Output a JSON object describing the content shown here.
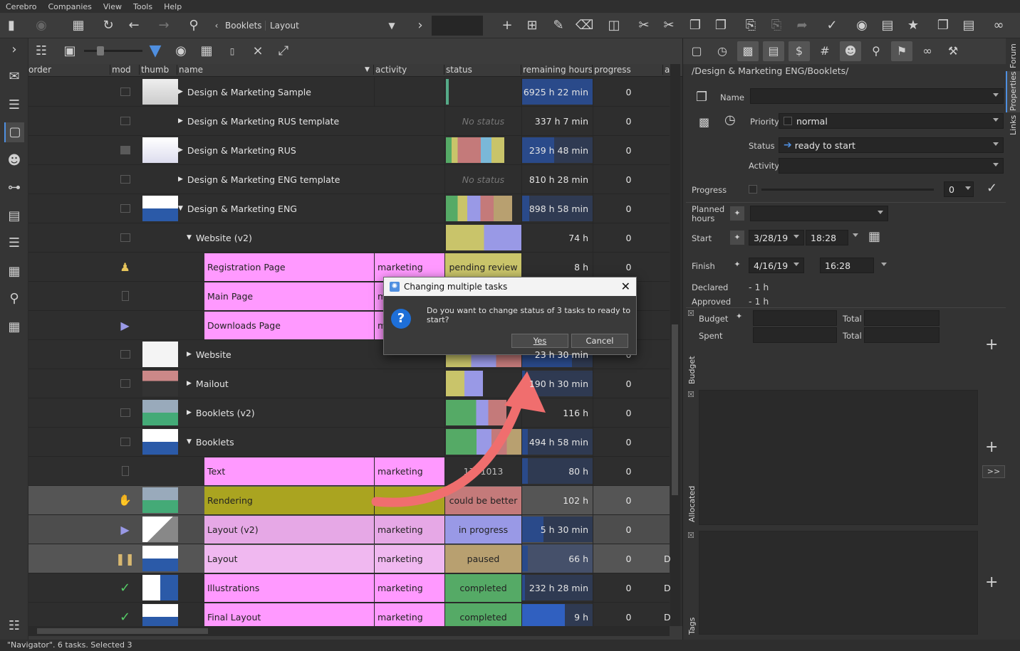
{
  "menu": [
    "Cerebro",
    "Companies",
    "View",
    "Tools",
    "Help"
  ],
  "breadcrumb": [
    "Booklets",
    "Layout"
  ],
  "columns": {
    "order": "order",
    "mod": "mod",
    "thumb": "thumb",
    "name": "name",
    "activity": "activity",
    "status": "status",
    "hours": "remaining hours",
    "progress": "progress",
    "extra": "a"
  },
  "rows": [
    {
      "name": "Design & Marketing Sample",
      "activity": "",
      "status": "",
      "hours": "6925 h 22 min",
      "progress": "0"
    },
    {
      "name": "Design & Marketing RUS template",
      "activity": "",
      "status": "No status",
      "hours": "337 h 7 min",
      "progress": "0"
    },
    {
      "name": "Design & Marketing RUS",
      "activity": "",
      "status": "",
      "hours": "239 h 48 min",
      "progress": "0"
    },
    {
      "name": "Design & Marketing ENG template",
      "activity": "",
      "status": "No status",
      "hours": "810 h 28 min",
      "progress": "0"
    },
    {
      "name": "Design & Marketing ENG",
      "activity": "",
      "status": "",
      "hours": "898 h 58 min",
      "progress": "0"
    },
    {
      "name": "Website (v2)",
      "activity": "",
      "status": "",
      "hours": "74 h",
      "progress": "0"
    },
    {
      "name": "Registration Page",
      "activity": "marketing",
      "status": "pending review",
      "hours": "8 h",
      "progress": "0"
    },
    {
      "name": "Main Page",
      "activity": "m",
      "status": "",
      "hours": "",
      "progress": ""
    },
    {
      "name": "Downloads Page",
      "activity": "m",
      "status": "",
      "hours": "",
      "progress": ""
    },
    {
      "name": "Website",
      "activity": "",
      "status": "",
      "hours": "23 h 30 min",
      "progress": "0"
    },
    {
      "name": "Mailout",
      "activity": "",
      "status": "",
      "hours": "190 h 30 min",
      "progress": "0"
    },
    {
      "name": "Booklets (v2)",
      "activity": "",
      "status": "",
      "hours": "116 h",
      "progress": "0"
    },
    {
      "name": "Booklets",
      "activity": "",
      "status": "",
      "hours": "494 h 58 min",
      "progress": "0"
    },
    {
      "name": "Text",
      "activity": "marketing",
      "status": "1741013",
      "hours": "80 h",
      "progress": "0"
    },
    {
      "name": "Rendering",
      "activity": "",
      "status": "could be better",
      "hours": "102 h",
      "progress": "0"
    },
    {
      "name": "Layout (v2)",
      "activity": "marketing",
      "status": "in progress",
      "hours": "5 h 30 min",
      "progress": "0"
    },
    {
      "name": "Layout",
      "activity": "marketing",
      "status": "paused",
      "hours": "66 h",
      "progress": "0",
      "extra": "D"
    },
    {
      "name": "Illustrations",
      "activity": "marketing",
      "status": "completed",
      "hours": "232 h 28 min",
      "progress": "0",
      "extra": "D"
    },
    {
      "name": "Final Layout",
      "activity": "marketing",
      "status": "completed",
      "hours": "9 h",
      "progress": "0",
      "extra": "D"
    }
  ],
  "props": {
    "path": "/Design & Marketing ENG/Booklets/",
    "name_label": "Name",
    "priority_label": "Priority",
    "priority_value": "normal",
    "status_label": "Status",
    "status_value": "ready to start",
    "activity_label": "Activity",
    "progress_label": "Progress",
    "progress_value": "0",
    "planned_label": "Planned hours",
    "start_label": "Start",
    "start_date": "3/28/19",
    "start_time": "18:28",
    "finish_label": "Finish",
    "finish_date": "4/16/19",
    "finish_time": "16:28",
    "declared_label": "Declared",
    "declared_value": "- 1 h",
    "approved_label": "Approved",
    "approved_value": "- 1 h",
    "budget_label": "Budget",
    "spent_label": "Spent",
    "total_label": "Total",
    "section_budget": "Budget",
    "section_allocated": "Allocated",
    "section_tags": "Tags",
    "more_button": ">>"
  },
  "side_tabs": [
    "Forum",
    "Properties",
    "Links"
  ],
  "dialog": {
    "title": "Changing multiple tasks",
    "message": "Do you want to change status of 3 tasks to ready to start?",
    "yes": "Yes",
    "cancel": "Cancel"
  },
  "statusbar": "\"Navigator\". 6 tasks. Selected 3",
  "colors": {
    "accent": "#4f8fe0",
    "task_pink": "#ff99ff",
    "completed": "#55aa66",
    "paused": "#b8a070",
    "in_progress": "#9999e6",
    "pending": "#c9c46a",
    "could_be_better": "#c47a7a",
    "annotation_arrow": "#f06e6e"
  }
}
